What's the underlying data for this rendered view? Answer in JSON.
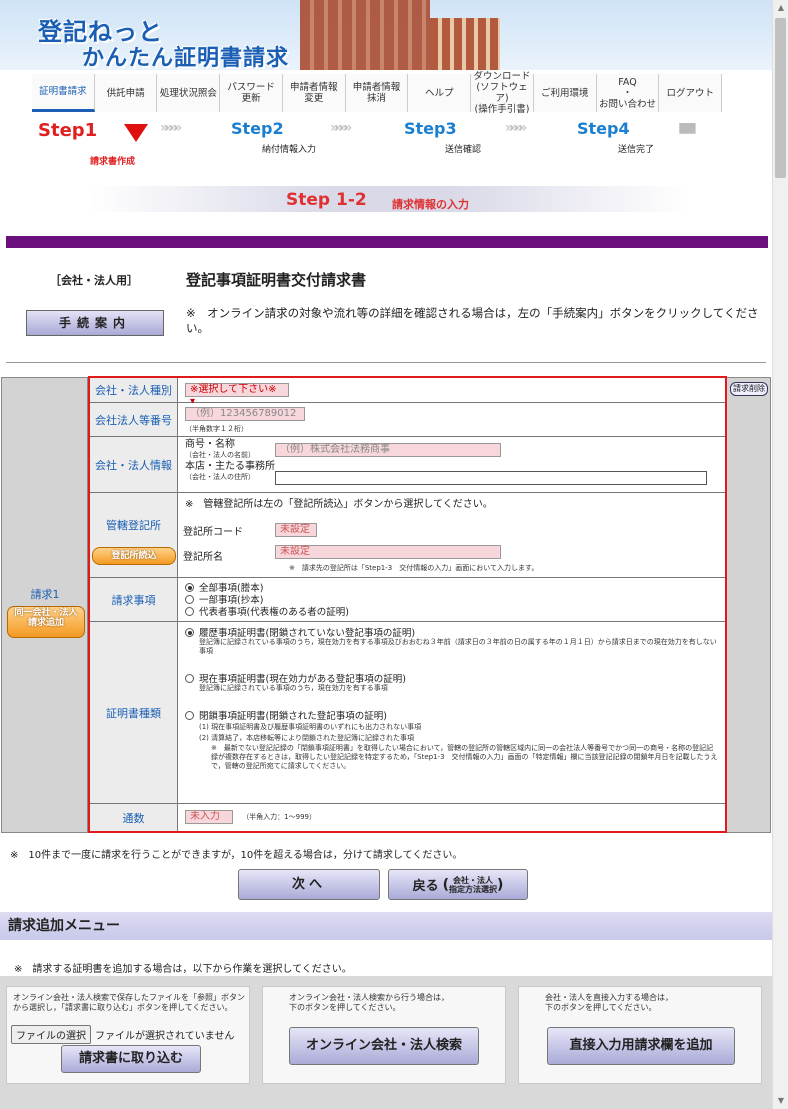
{
  "header": {
    "logo_line1": "登記ねっと",
    "logo_line2": "かんたん証明書請求"
  },
  "nav": [
    {
      "label": "証明書請求",
      "active": true
    },
    {
      "label": "供託申請"
    },
    {
      "label": "処理状況照会"
    },
    {
      "label": "パスワード\n更新"
    },
    {
      "label": "申請者情報\n変更"
    },
    {
      "label": "申請者情報\n抹消"
    },
    {
      "label": "ヘルプ"
    },
    {
      "label": "ダウンロード\n(ソフトウェア)\n(操作手引書)"
    },
    {
      "label": "ご利用環境"
    },
    {
      "label": "FAQ\n・\nお問い合わせ"
    },
    {
      "label": "ログアウト"
    }
  ],
  "steps": {
    "s1": "Step1",
    "s1_sub": "請求書作成",
    "s2": "Step2",
    "s2_sub": "納付情報入力",
    "s3": "Step3",
    "s3_sub": "送信確認",
    "s4": "Step4",
    "s4_sub": "送信完了",
    "current": "Step 1-2",
    "current_sub": "請求情報の入力"
  },
  "intro": {
    "usage": "［会社・法人用］",
    "title": "登記事項証明書交付請求書",
    "guide_button": "手続案内",
    "guide_note": "※　オンライン請求の対象や流れ等の詳細を確認される場合は，左の「手続案内」ボタンをクリックしてください。"
  },
  "form": {
    "left_label": "請求1",
    "add_same_button": "同一会社・法人\n請求追加",
    "delete_button": "請求削除",
    "company_type": {
      "label": "会社・法人種別",
      "value": "※選択して下さい※"
    },
    "corp_number": {
      "label": "会社法人等番号",
      "placeholder": "（例）123456789012",
      "hint": "（半角数字１２桁）"
    },
    "company_info": {
      "label": "会社・法人情報",
      "name_label": "商号・名称",
      "name_sub": "（会社・法人の名前）",
      "name_placeholder": "（例）株式会社法務商事",
      "addr_label": "本店・主たる事務所",
      "addr_sub": "（会社・法人の住所）"
    },
    "registry": {
      "label": "管轄登記所",
      "load_button": "登記所読込",
      "note": "※　管轄登記所は左の「登記所読込」ボタンから選択してください。",
      "code_label": "登記所コード",
      "code_value": "未設定",
      "name_label": "登記所名",
      "name_value": "未設定",
      "name_note": "※　請求先の登記所は「Step1-3　交付情報の入力」画面において入力します。"
    },
    "items": {
      "label": "請求事項",
      "options": [
        "全部事項(謄本)",
        "一部事項(抄本)",
        "代表者事項(代表権のある者の証明)"
      ],
      "selected": 0
    },
    "cert_types": {
      "label": "証明書種類",
      "opt1": "履歴事項証明書(閉鎖されていない登記事項の証明)",
      "opt1_desc": "登記簿に記録されている事項のうち，現在効力を有する事項及びおおむね３年前（請求日の３年前の日の属する年の１月１日）から請求日までの現在効力を有しない事項",
      "opt2": "現在事項証明書(現在効力がある登記事項の証明)",
      "opt2_desc": "登記簿に記録されている事項のうち，現在効力を有する事項",
      "opt3": "閉鎖事項証明書(閉鎖された登記事項の証明)",
      "opt3_desc1": "(1) 現在事項証明書及び履歴事項証明書のいずれにも出力されない事項",
      "opt3_desc2": "(2) 清算結了，本店移転等により閉鎖された登記簿に記録された事項",
      "opt3_note": "※　最新でない登記記録の「閉鎖事項証明書」を取得したい場合において，管轄の登記所の管轄区域内に同一の会社法人等番号でかつ同一の商号・名称の登記記録が複数存在するときは，取得したい登記記録を特定するため，「Step1-3　交付情報の入力」画面の「特定情報」欄に当該登記記録の閉鎖年月日を記載したうえで，管轄の登記所宛てに請求してください。"
    },
    "copies": {
      "label": "通数",
      "placeholder": "未入力",
      "hint": "（半角入力：1〜999）"
    }
  },
  "bottom": {
    "note": "※　10件まで一度に請求を行うことができますが，10件を超える場合は，分けて請求してください。",
    "next_button": "次へ",
    "back_button": "戻る",
    "back_sub": "会社・法人\n指定方法選択",
    "add_menu_title": "請求追加メニュー",
    "add_menu_note": "※　請求する証明書を追加する場合は，以下から作業を選択してください。",
    "box1_text": "オンライン会社・法人検索で保存したファイルを「参照」ボタンから選択し，「請求書に取り込む」ボタンを押してください。",
    "file_button": "ファイルの選択",
    "file_status": "ファイルが選択されていません",
    "box1_button": "請求書に取り込む",
    "box2_text": "オンライン会社・法人検索から行う場合は，\n下のボタンを押してください。",
    "box2_button": "オンライン会社・法人検索",
    "box3_text": "会社・法人を直接入力する場合は，\n下のボタンを押してください。",
    "box3_button": "直接入力用請求欄を追加"
  }
}
